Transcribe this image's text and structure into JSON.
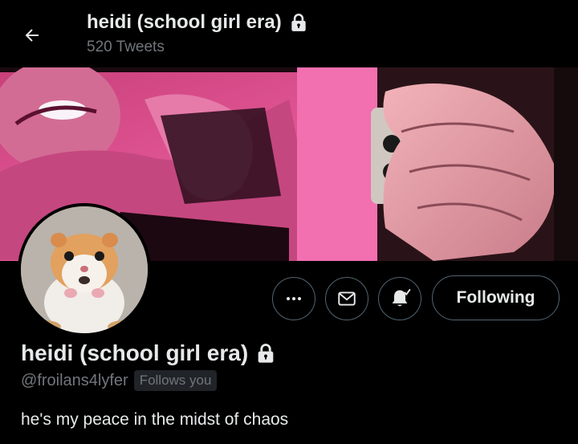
{
  "header": {
    "title": "heidi (school girl era)",
    "tweet_count": "520 Tweets"
  },
  "actions": {
    "following_label": "Following"
  },
  "profile": {
    "display_name": "heidi (school girl era)",
    "handle": "@froilans4lyfer",
    "follows_you": "Follows you",
    "bio": "he's my peace in the midst of chaos"
  },
  "icons": {
    "back": "arrow-left-icon",
    "lock": "lock-icon",
    "more": "more-horizontal-icon",
    "message": "envelope-icon",
    "notifications": "bell-check-icon"
  },
  "colors": {
    "background": "#000000",
    "text_primary": "#e7e9ea",
    "text_secondary": "#71767b",
    "button_border": "#536471",
    "badge_bg": "#202327",
    "banner_pink": "#d94f8a"
  }
}
